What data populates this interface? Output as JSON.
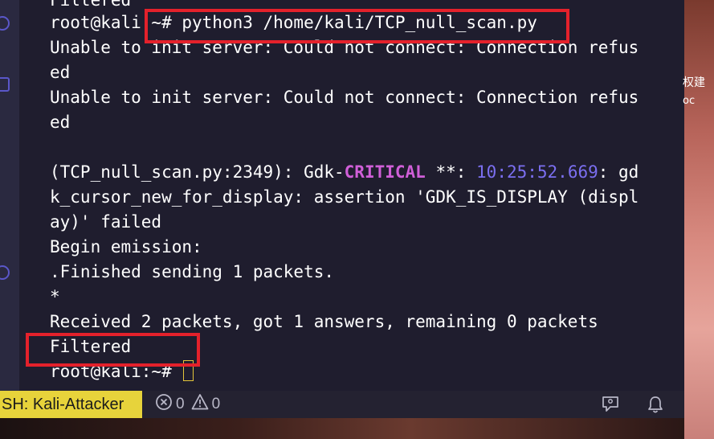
{
  "terminal": {
    "lines": [
      "Filtered",
      "root@kali:~# python3 /home/kali/TCP_null_scan.py",
      "Unable to init server: Could not connect: Connection refus",
      "ed",
      "Unable to init server: Could not connect: Connection refus",
      "ed",
      "",
      "(TCP_null_scan.py:2349): Gdk-",
      "CRITICAL",
      " **: ",
      "10:25:52.669",
      ": gd",
      "k_cursor_new_for_display: assertion 'GDK_IS_DISPLAY (displ",
      "ay)' failed",
      "Begin emission:",
      ".Finished sending 1 packets.",
      "*",
      "Received 2 packets, got 1 answers, remaining 0 packets",
      "Filtered",
      "root@kali:~# "
    ]
  },
  "statusbar": {
    "remote_label": "SH: Kali-Attacker",
    "errors_count": "0",
    "warnings_count": "0",
    "icons": [
      "error-circle-icon",
      "warning-triangle-icon",
      "feedback-icon",
      "bell-icon"
    ]
  },
  "wallpaper": {
    "fragment1": "权建",
    "fragment2": "oc"
  },
  "colors": {
    "terminal_bg": "#1f1d2e",
    "critical": "#d05fd8",
    "timestamp": "#7b6ff0",
    "highlight_box": "#e4212b",
    "remote_badge": "#e7d33b"
  }
}
